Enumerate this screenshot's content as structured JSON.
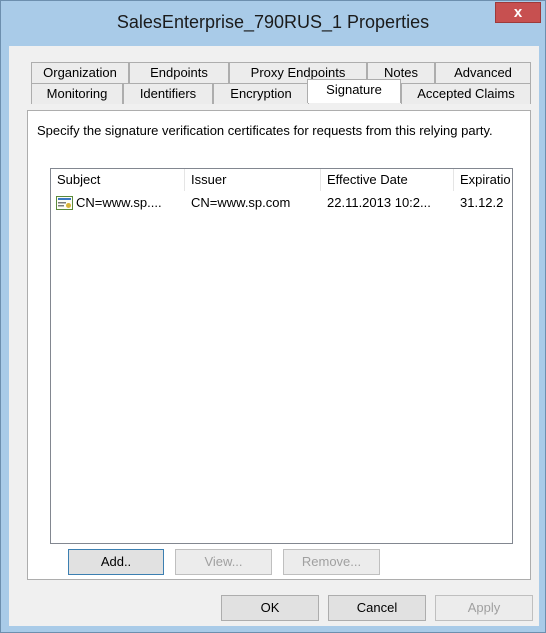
{
  "window": {
    "title": "SalesEnterprise_790RUS_1 Properties",
    "close_glyph": "x"
  },
  "tabs_row1": [
    "Organization",
    "Endpoints",
    "Proxy Endpoints",
    "Notes",
    "Advanced"
  ],
  "tabs_row2": [
    "Monitoring",
    "Identifiers",
    "Encryption",
    "Signature",
    "Accepted Claims"
  ],
  "active_tab": "Signature",
  "signature": {
    "description": "Specify the signature verification certificates for requests from this relying party.",
    "columns": [
      "Subject",
      "Issuer",
      "Effective Date",
      "Expiratio"
    ],
    "rows": [
      {
        "subject": "CN=www.sp....",
        "issuer": "CN=www.sp.com",
        "effective": "22.11.2013 10:2...",
        "expiration": "31.12.2"
      }
    ]
  },
  "list_buttons": {
    "add": "Add..",
    "view": "View...",
    "remove": "Remove..."
  },
  "footer_buttons": {
    "ok": "OK",
    "cancel": "Cancel",
    "apply": "Apply"
  }
}
